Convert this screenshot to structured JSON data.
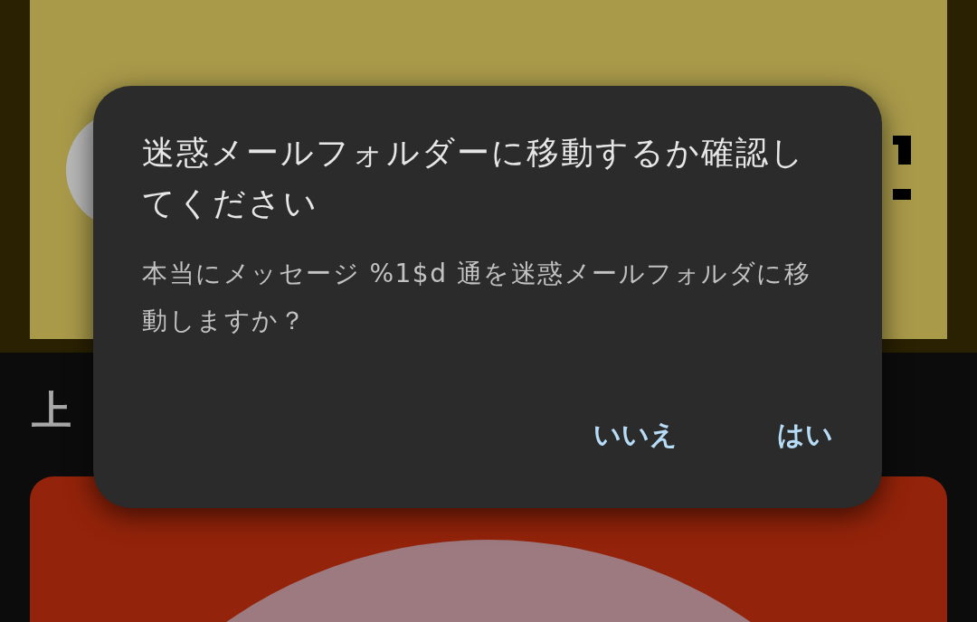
{
  "background": {
    "heading": "上"
  },
  "dialog": {
    "title": "迷惑メールフォルダーに移動するか確認してください",
    "message": "本当にメッセージ %1$d 通を迷惑メールフォルダに移動しますか？",
    "buttons": [
      {
        "label": "いいえ"
      },
      {
        "label": "はい"
      }
    ]
  }
}
